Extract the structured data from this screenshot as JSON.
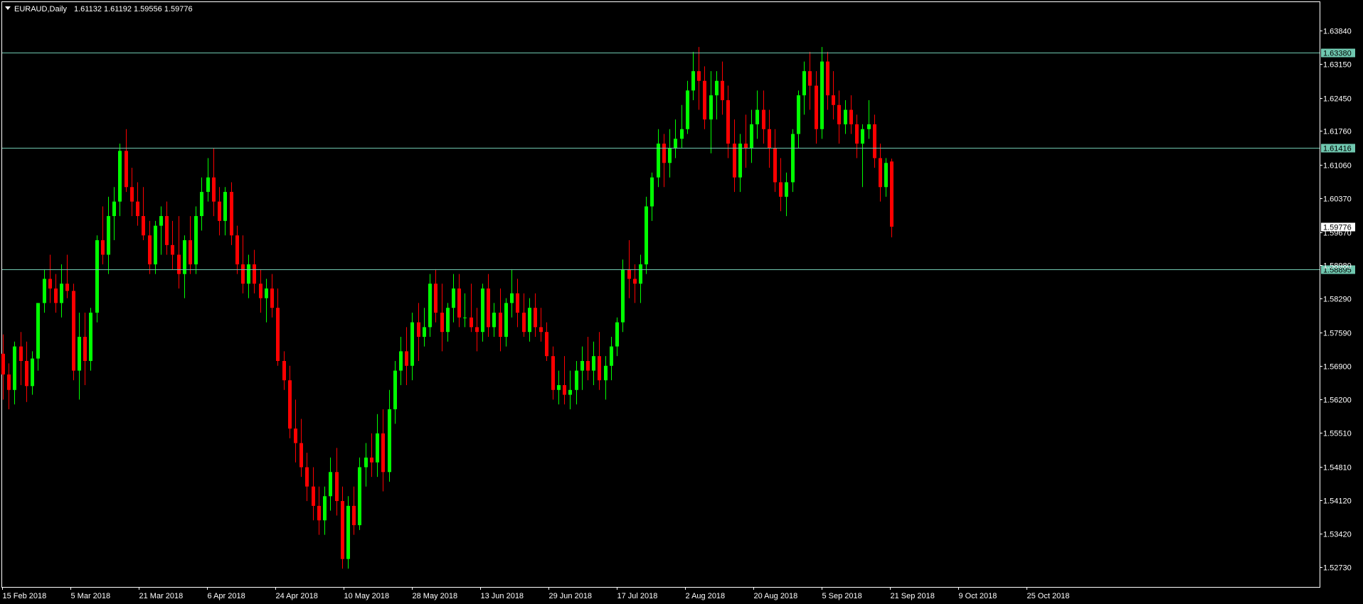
{
  "header": {
    "symbol": "EURAUD,Daily",
    "ohlc": "1.61132 1.61192 1.59556 1.59776"
  },
  "colors": {
    "background": "#000000",
    "frame": "#ffffff",
    "bull": "#00ff00",
    "bear": "#ff0000",
    "level_line": "#70c8b0",
    "level_label_bg": "#70c8b0",
    "price_label_bg": "#ffffff"
  },
  "chart_data": {
    "type": "candlestick",
    "title": "EURAUD,Daily",
    "xlabel": "",
    "ylabel": "",
    "ylim": [
      1.5238,
      1.6415
    ],
    "y_ticks": [
      "1.63840",
      "1.63150",
      "1.62450",
      "1.61760",
      "1.61060",
      "1.60370",
      "1.59670",
      "1.58980",
      "1.58290",
      "1.57590",
      "1.56900",
      "1.56200",
      "1.55510",
      "1.54810",
      "1.54120",
      "1.53420",
      "1.52730"
    ],
    "x_ticks": [
      "15 Feb 2018",
      "5 Mar 2018",
      "21 Mar 2018",
      "6 Apr 2018",
      "24 Apr 2018",
      "10 May 2018",
      "28 May 2018",
      "13 Jun 2018",
      "29 Jun 2018",
      "17 Jul 2018",
      "2 Aug 2018",
      "20 Aug 2018",
      "5 Sep 2018",
      "21 Sep 2018",
      "9 Oct 2018",
      "25 Oct 2018"
    ],
    "horizontal_levels": [
      1.6338,
      1.61416,
      1.58895
    ],
    "level_labels": [
      "1.63380",
      "1.61416",
      "1.58895"
    ],
    "current_price": 1.59776,
    "current_price_label": "1.59776",
    "grid": false,
    "candles": [
      [
        1.5715,
        1.5755,
        1.562,
        1.5672
      ],
      [
        1.5672,
        1.5695,
        1.56,
        1.564
      ],
      [
        1.564,
        1.574,
        1.561,
        1.573
      ],
      [
        1.573,
        1.576,
        1.565,
        1.57
      ],
      [
        1.57,
        1.574,
        1.5615,
        1.5648
      ],
      [
        1.5648,
        1.572,
        1.563,
        1.5705
      ],
      [
        1.5705,
        1.579,
        1.568,
        1.582
      ],
      [
        1.582,
        1.589,
        1.58,
        1.587
      ],
      [
        1.587,
        1.592,
        1.582,
        1.585
      ],
      [
        1.585,
        1.588,
        1.58,
        1.582
      ],
      [
        1.582,
        1.59,
        1.579,
        1.586
      ],
      [
        1.586,
        1.592,
        1.583,
        1.5845
      ],
      [
        1.5845,
        1.586,
        1.566,
        1.568
      ],
      [
        1.568,
        1.58,
        1.562,
        1.575
      ],
      [
        1.575,
        1.58,
        1.565,
        1.57
      ],
      [
        1.57,
        1.581,
        1.568,
        1.58
      ],
      [
        1.58,
        1.596,
        1.578,
        1.595
      ],
      [
        1.595,
        1.602,
        1.59,
        1.592
      ],
      [
        1.592,
        1.604,
        1.588,
        1.6
      ],
      [
        1.6,
        1.606,
        1.595,
        1.603
      ],
      [
        1.603,
        1.615,
        1.6,
        1.6135
      ],
      [
        1.6135,
        1.618,
        1.605,
        1.606
      ],
      [
        1.606,
        1.61,
        1.6,
        1.603
      ],
      [
        1.603,
        1.607,
        1.598,
        1.6
      ],
      [
        1.6,
        1.606,
        1.595,
        1.596
      ],
      [
        1.596,
        1.599,
        1.588,
        1.59
      ],
      [
        1.59,
        1.599,
        1.588,
        1.598
      ],
      [
        1.598,
        1.602,
        1.592,
        1.6
      ],
      [
        1.6,
        1.603,
        1.592,
        1.594
      ],
      [
        1.594,
        1.599,
        1.589,
        1.592
      ],
      [
        1.592,
        1.6,
        1.585,
        1.588
      ],
      [
        1.588,
        1.596,
        1.583,
        1.595
      ],
      [
        1.595,
        1.6,
        1.588,
        1.59
      ],
      [
        1.59,
        1.602,
        1.588,
        1.6
      ],
      [
        1.6,
        1.608,
        1.597,
        1.605
      ],
      [
        1.605,
        1.612,
        1.603,
        1.608
      ],
      [
        1.608,
        1.614,
        1.6,
        1.603
      ],
      [
        1.603,
        1.606,
        1.596,
        1.599
      ],
      [
        1.599,
        1.606,
        1.596,
        1.605
      ],
      [
        1.605,
        1.607,
        1.594,
        1.596
      ],
      [
        1.596,
        1.598,
        1.588,
        1.59
      ],
      [
        1.59,
        1.596,
        1.584,
        1.586
      ],
      [
        1.586,
        1.592,
        1.583,
        1.59
      ],
      [
        1.59,
        1.593,
        1.584,
        1.586
      ],
      [
        1.586,
        1.589,
        1.58,
        1.583
      ],
      [
        1.583,
        1.587,
        1.578,
        1.585
      ],
      [
        1.585,
        1.588,
        1.579,
        1.581
      ],
      [
        1.581,
        1.585,
        1.569,
        1.57
      ],
      [
        1.57,
        1.572,
        1.564,
        1.566
      ],
      [
        1.566,
        1.569,
        1.554,
        1.556
      ],
      [
        1.556,
        1.562,
        1.549,
        1.553
      ],
      [
        1.553,
        1.558,
        1.546,
        1.548
      ],
      [
        1.548,
        1.551,
        1.541,
        1.544
      ],
      [
        1.544,
        1.548,
        1.537,
        1.54
      ],
      [
        1.54,
        1.544,
        1.534,
        1.537
      ],
      [
        1.537,
        1.544,
        1.534,
        1.542
      ],
      [
        1.542,
        1.55,
        1.539,
        1.547
      ],
      [
        1.547,
        1.552,
        1.538,
        1.541
      ],
      [
        1.541,
        1.544,
        1.527,
        1.529
      ],
      [
        1.529,
        1.542,
        1.527,
        1.54
      ],
      [
        1.54,
        1.544,
        1.534,
        1.536
      ],
      [
        1.536,
        1.55,
        1.535,
        1.548
      ],
      [
        1.548,
        1.553,
        1.544,
        1.55
      ],
      [
        1.55,
        1.555,
        1.546,
        1.549
      ],
      [
        1.549,
        1.559,
        1.546,
        1.555
      ],
      [
        1.555,
        1.56,
        1.543,
        1.547
      ],
      [
        1.547,
        1.564,
        1.545,
        1.56
      ],
      [
        1.56,
        1.57,
        1.557,
        1.568
      ],
      [
        1.568,
        1.575,
        1.565,
        1.572
      ],
      [
        1.572,
        1.577,
        1.565,
        1.569
      ],
      [
        1.569,
        1.58,
        1.566,
        1.578
      ],
      [
        1.578,
        1.582,
        1.57,
        1.575
      ],
      [
        1.575,
        1.581,
        1.573,
        1.577
      ],
      [
        1.577,
        1.588,
        1.575,
        1.586
      ],
      [
        1.586,
        1.589,
        1.578,
        1.58
      ],
      [
        1.58,
        1.586,
        1.572,
        1.576
      ],
      [
        1.576,
        1.582,
        1.574,
        1.581
      ],
      [
        1.581,
        1.588,
        1.578,
        1.585
      ],
      [
        1.585,
        1.588,
        1.577,
        1.579
      ],
      [
        1.579,
        1.584,
        1.577,
        1.579
      ],
      [
        1.579,
        1.586,
        1.576,
        1.577
      ],
      [
        1.577,
        1.581,
        1.572,
        1.576
      ],
      [
        1.576,
        1.586,
        1.574,
        1.585
      ],
      [
        1.585,
        1.588,
        1.575,
        1.577
      ],
      [
        1.577,
        1.582,
        1.575,
        1.58
      ],
      [
        1.58,
        1.585,
        1.572,
        1.575
      ],
      [
        1.575,
        1.583,
        1.573,
        1.582
      ],
      [
        1.582,
        1.589,
        1.579,
        1.584
      ],
      [
        1.584,
        1.587,
        1.577,
        1.58
      ],
      [
        1.58,
        1.584,
        1.575,
        1.576
      ],
      [
        1.576,
        1.583,
        1.574,
        1.581
      ],
      [
        1.581,
        1.584,
        1.575,
        1.577
      ],
      [
        1.577,
        1.581,
        1.574,
        1.576
      ],
      [
        1.576,
        1.578,
        1.57,
        1.571
      ],
      [
        1.571,
        1.573,
        1.562,
        1.564
      ],
      [
        1.564,
        1.568,
        1.561,
        1.565
      ],
      [
        1.565,
        1.571,
        1.561,
        1.563
      ],
      [
        1.563,
        1.568,
        1.56,
        1.564
      ],
      [
        1.564,
        1.57,
        1.561,
        1.568
      ],
      [
        1.568,
        1.573,
        1.564,
        1.57
      ],
      [
        1.57,
        1.575,
        1.566,
        1.568
      ],
      [
        1.568,
        1.574,
        1.565,
        1.571
      ],
      [
        1.571,
        1.576,
        1.564,
        1.566
      ],
      [
        1.566,
        1.571,
        1.562,
        1.569
      ],
      [
        1.569,
        1.575,
        1.566,
        1.573
      ],
      [
        1.573,
        1.579,
        1.571,
        1.578
      ],
      [
        1.578,
        1.591,
        1.576,
        1.589
      ],
      [
        1.589,
        1.595,
        1.583,
        1.587
      ],
      [
        1.587,
        1.59,
        1.582,
        1.586
      ],
      [
        1.586,
        1.592,
        1.582,
        1.59
      ],
      [
        1.59,
        1.604,
        1.588,
        1.602
      ],
      [
        1.602,
        1.609,
        1.599,
        1.608
      ],
      [
        1.608,
        1.618,
        1.606,
        1.615
      ],
      [
        1.615,
        1.617,
        1.606,
        1.611
      ],
      [
        1.611,
        1.618,
        1.608,
        1.614
      ],
      [
        1.614,
        1.62,
        1.612,
        1.616
      ],
      [
        1.616,
        1.623,
        1.614,
        1.618
      ],
      [
        1.618,
        1.628,
        1.617,
        1.626
      ],
      [
        1.626,
        1.634,
        1.624,
        1.63
      ],
      [
        1.63,
        1.635,
        1.622,
        1.628
      ],
      [
        1.628,
        1.631,
        1.618,
        1.62
      ],
      [
        1.62,
        1.63,
        1.613,
        1.625
      ],
      [
        1.625,
        1.63,
        1.62,
        1.628
      ],
      [
        1.628,
        1.632,
        1.621,
        1.624
      ],
      [
        1.624,
        1.627,
        1.612,
        1.615
      ],
      [
        1.615,
        1.62,
        1.605,
        1.608
      ],
      [
        1.608,
        1.617,
        1.605,
        1.615
      ],
      [
        1.615,
        1.621,
        1.61,
        1.614
      ],
      [
        1.614,
        1.622,
        1.611,
        1.619
      ],
      [
        1.619,
        1.626,
        1.616,
        1.622
      ],
      [
        1.622,
        1.626,
        1.615,
        1.618
      ],
      [
        1.618,
        1.622,
        1.61,
        1.614
      ],
      [
        1.614,
        1.618,
        1.605,
        1.607
      ],
      [
        1.607,
        1.612,
        1.601,
        1.604
      ],
      [
        1.604,
        1.609,
        1.6,
        1.607
      ],
      [
        1.607,
        1.618,
        1.605,
        1.617
      ],
      [
        1.617,
        1.626,
        1.614,
        1.625
      ],
      [
        1.625,
        1.632,
        1.621,
        1.63
      ],
      [
        1.63,
        1.634,
        1.622,
        1.627
      ],
      [
        1.627,
        1.63,
        1.615,
        1.618
      ],
      [
        1.618,
        1.635,
        1.616,
        1.632
      ],
      [
        1.632,
        1.634,
        1.622,
        1.625
      ],
      [
        1.625,
        1.63,
        1.62,
        1.623
      ],
      [
        1.623,
        1.626,
        1.615,
        1.619
      ],
      [
        1.619,
        1.624,
        1.617,
        1.622
      ],
      [
        1.622,
        1.625,
        1.617,
        1.619
      ],
      [
        1.619,
        1.621,
        1.612,
        1.615
      ],
      [
        1.615,
        1.619,
        1.606,
        1.618
      ],
      [
        1.618,
        1.624,
        1.616,
        1.619
      ],
      [
        1.619,
        1.621,
        1.61,
        1.612
      ],
      [
        1.612,
        1.615,
        1.603,
        1.606
      ],
      [
        1.606,
        1.612,
        1.604,
        1.611
      ],
      [
        1.6113,
        1.6119,
        1.5956,
        1.5978
      ]
    ]
  }
}
